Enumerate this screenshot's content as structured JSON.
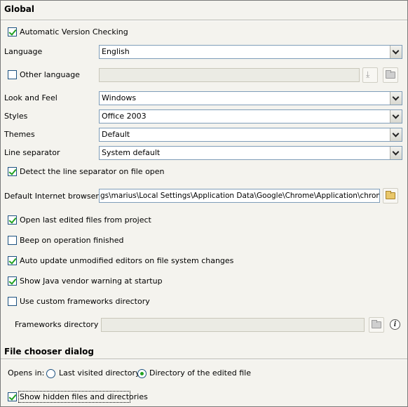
{
  "global": {
    "title": "Global",
    "auto_version_checking": {
      "label": "Automatic Version Checking",
      "checked": true
    },
    "language": {
      "label": "Language",
      "value": "English"
    },
    "other_language": {
      "label": "Other language",
      "checked": false,
      "value": ""
    },
    "look_and_feel": {
      "label": "Look and Feel",
      "value": "Windows"
    },
    "styles": {
      "label": "Styles",
      "value": "Office 2003"
    },
    "themes": {
      "label": "Themes",
      "value": "Default"
    },
    "line_separator": {
      "label": "Line separator",
      "value": "System default"
    },
    "detect_line_separator": {
      "label": "Detect the line separator on file open",
      "checked": true
    },
    "default_browser": {
      "label": "Default Internet browser",
      "value": "gs\\marius\\Local Settings\\Application Data\\Google\\Chrome\\Application\\chrome.exe"
    },
    "open_last_edited": {
      "label": "Open last edited files from project",
      "checked": true
    },
    "beep_on_finish": {
      "label": "Beep on operation finished",
      "checked": false
    },
    "auto_update_editors": {
      "label": "Auto update unmodified editors on file system changes",
      "checked": true
    },
    "java_vendor_warning": {
      "label": "Show Java vendor warning at startup",
      "checked": true
    },
    "custom_frameworks": {
      "label": "Use custom frameworks directory",
      "checked": false
    },
    "frameworks_directory": {
      "label": "Frameworks directory",
      "value": ""
    }
  },
  "file_chooser": {
    "title": "File chooser dialog",
    "opens_in_label": "Opens in:",
    "last_visited": {
      "label": "Last visited directory",
      "selected": false
    },
    "edited_file_dir": {
      "label": "Directory of the edited file",
      "selected": true
    },
    "show_hidden": {
      "label": "Show hidden files and directories",
      "checked": true
    }
  },
  "icons": {
    "folder": "folder-icon",
    "download": "download-icon",
    "info": "info-icon",
    "dropdown": "chevron-down-icon"
  },
  "colors": {
    "panel_bg": "#f4f3ee",
    "check_green": "#21a121",
    "field_border": "#7f9db9"
  }
}
